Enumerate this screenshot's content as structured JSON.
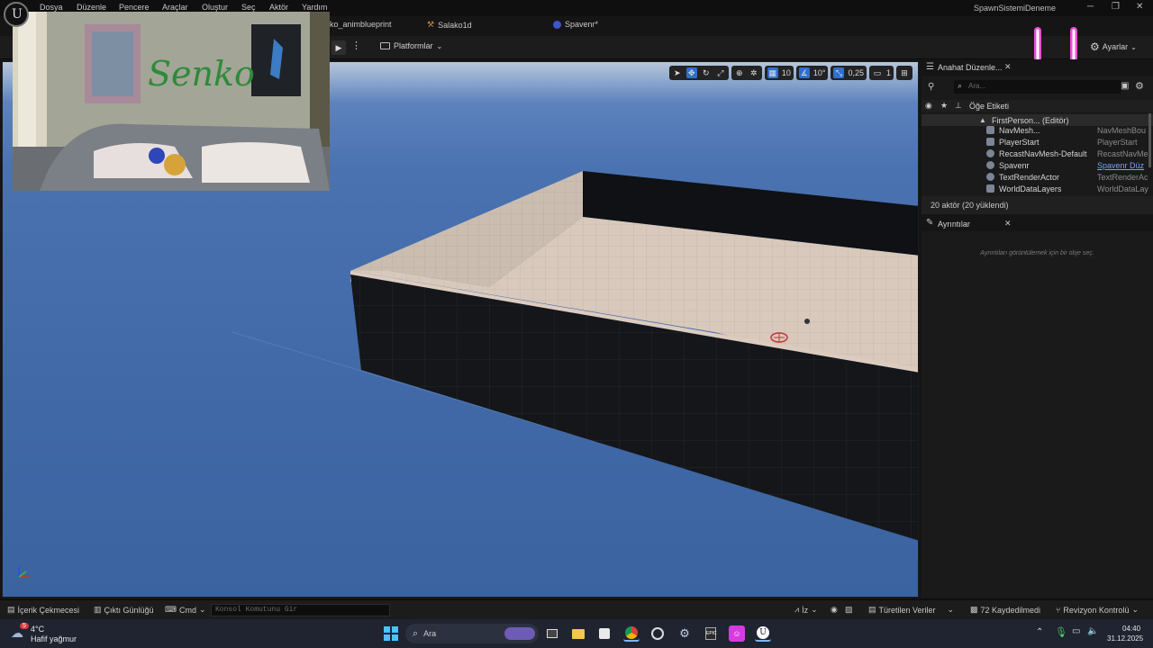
{
  "menu": [
    "Dosya",
    "Düzenle",
    "Pencere",
    "Araçlar",
    "Oluştur",
    "Seç",
    "Aktör",
    "Yardım"
  ],
  "app_title": "SpawnSistemiDeneme",
  "tabs": [
    {
      "label": "ko_animblueprint"
    },
    {
      "label": "Salako1d"
    },
    {
      "label": "Spavenr*"
    }
  ],
  "toolbar": {
    "platforms_label": "Platformlar",
    "settings_label": "Ayarlar"
  },
  "viewport_toolbar": {
    "grid_snap": "10",
    "rotation_snap": "10°",
    "scale_snap": "0,25",
    "camera_speed": "1"
  },
  "outliner": {
    "tab_label": "Anahat Düzenle...",
    "search_placeholder": "Ara...",
    "column_label": "Öğe Etiketi",
    "root_item": "FirstPerson... (Editör)",
    "items": [
      {
        "name": "NavMesh...",
        "type": "NavMeshBou"
      },
      {
        "name": "PlayerStart",
        "type": "PlayerStart"
      },
      {
        "name": "RecastNavMesh-Default",
        "type": "RecastNavMe"
      },
      {
        "name": "Spavenr",
        "type": "Spavenr Düz"
      },
      {
        "name": "TextRenderActor",
        "type": "TextRenderAc"
      },
      {
        "name": "WorldDataLayers",
        "type": "WorldDataLay"
      }
    ],
    "footer": "20 aktör (20 yüklendi)"
  },
  "details": {
    "tab_label": "Ayrıntılar",
    "empty_message": "Ayrıntıları görüntülemek için bir obje seç."
  },
  "statusbar": {
    "content_drawer": "İçerik Çekmecesi",
    "output_log": "Çıktı Günlüğü",
    "cmd_label": "Cmd",
    "console_placeholder": "Konsol Komutunu Gir",
    "trace_label": "İz",
    "derived_data": "Türetilen Veriler",
    "unsaved": "72 Kaydedilmedi",
    "revision_control": "Revizyon Kontrolü"
  },
  "taskbar": {
    "weather_temp": "4°C",
    "weather_desc": "Hafif yağmur",
    "search_label": "Ara",
    "time": "04:40",
    "date": "31.12.2025",
    "notification_count": "5"
  },
  "colors": {
    "accent": "#2f6fcf",
    "sky_top": "#b7c6d9",
    "sky": "#4169a8",
    "floor": "#d7c8bb",
    "wall_dark": "#121418",
    "overlay_pink": "#e84fd6"
  }
}
